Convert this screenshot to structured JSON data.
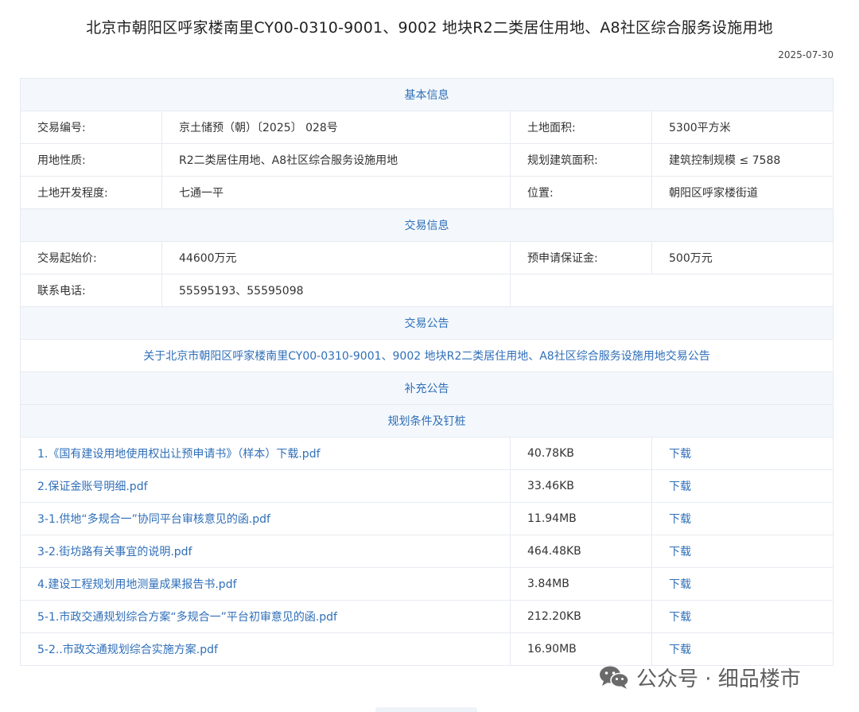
{
  "page": {
    "title": "北京市朝阳区呼家楼南里CY00-0310-9001、9002 地块R2二类居住用地、A8社区综合服务设施用地",
    "date": "2025-07-30"
  },
  "basic_info": {
    "section_title": "基本信息",
    "rows": [
      {
        "label1": "交易编号:",
        "value1": "京土储预（朝）〔2025〕 028号",
        "label2": "土地面积:",
        "value2": "5300平方米"
      },
      {
        "label1": "用地性质:",
        "value1": "R2二类居住用地、A8社区综合服务设施用地",
        "label2": "规划建筑面积:",
        "value2": "建筑控制规模 ≤ 7588"
      },
      {
        "label1": "土地开发程度:",
        "value1": "七通一平",
        "label2": "位置:",
        "value2": "朝阳区呼家楼街道"
      }
    ]
  },
  "trade_info": {
    "section_title": "交易信息",
    "rows": [
      {
        "label1": "交易起始价:",
        "value1": "44600万元",
        "label2": "预申请保证金:",
        "value2": "500万元"
      },
      {
        "label1": "联系电话:",
        "value1": "55595193、55595098"
      }
    ]
  },
  "trade_notice": {
    "section_title": "交易公告",
    "link_text": "关于北京市朝阳区呼家楼南里CY00-0310-9001、9002 地块R2二类居住用地、A8社区综合服务设施用地交易公告"
  },
  "supplement": {
    "section_title": "补充公告"
  },
  "planning": {
    "section_title": "规划条件及钉桩",
    "files": [
      {
        "name": "1.《国有建设用地使用权出让预申请书》（样本）下载.pdf",
        "size": "40.78KB",
        "action": "下载"
      },
      {
        "name": "2.保证金账号明细.pdf",
        "size": "33.46KB",
        "action": "下载"
      },
      {
        "name": "3-1.供地“多规合一”协同平台审核意见的函.pdf",
        "size": "11.94MB",
        "action": "下载"
      },
      {
        "name": "3-2.街坊路有关事宜的说明.pdf",
        "size": "464.48KB",
        "action": "下载"
      },
      {
        "name": "4.建设工程规划用地测量成果报告书.pdf",
        "size": "3.84MB",
        "action": "下载"
      },
      {
        "name": "5-1.市政交通规划综合方案“多规合一”平台初审意见的函.pdf",
        "size": "212.20KB",
        "action": "下载"
      },
      {
        "name": "5-2..市政交通规划综合实施方案.pdf",
        "size": "16.90MB",
        "action": "下载"
      }
    ]
  },
  "watermark": {
    "text": "公众号 · 细品楼市",
    "icon": "wechat-icon"
  }
}
